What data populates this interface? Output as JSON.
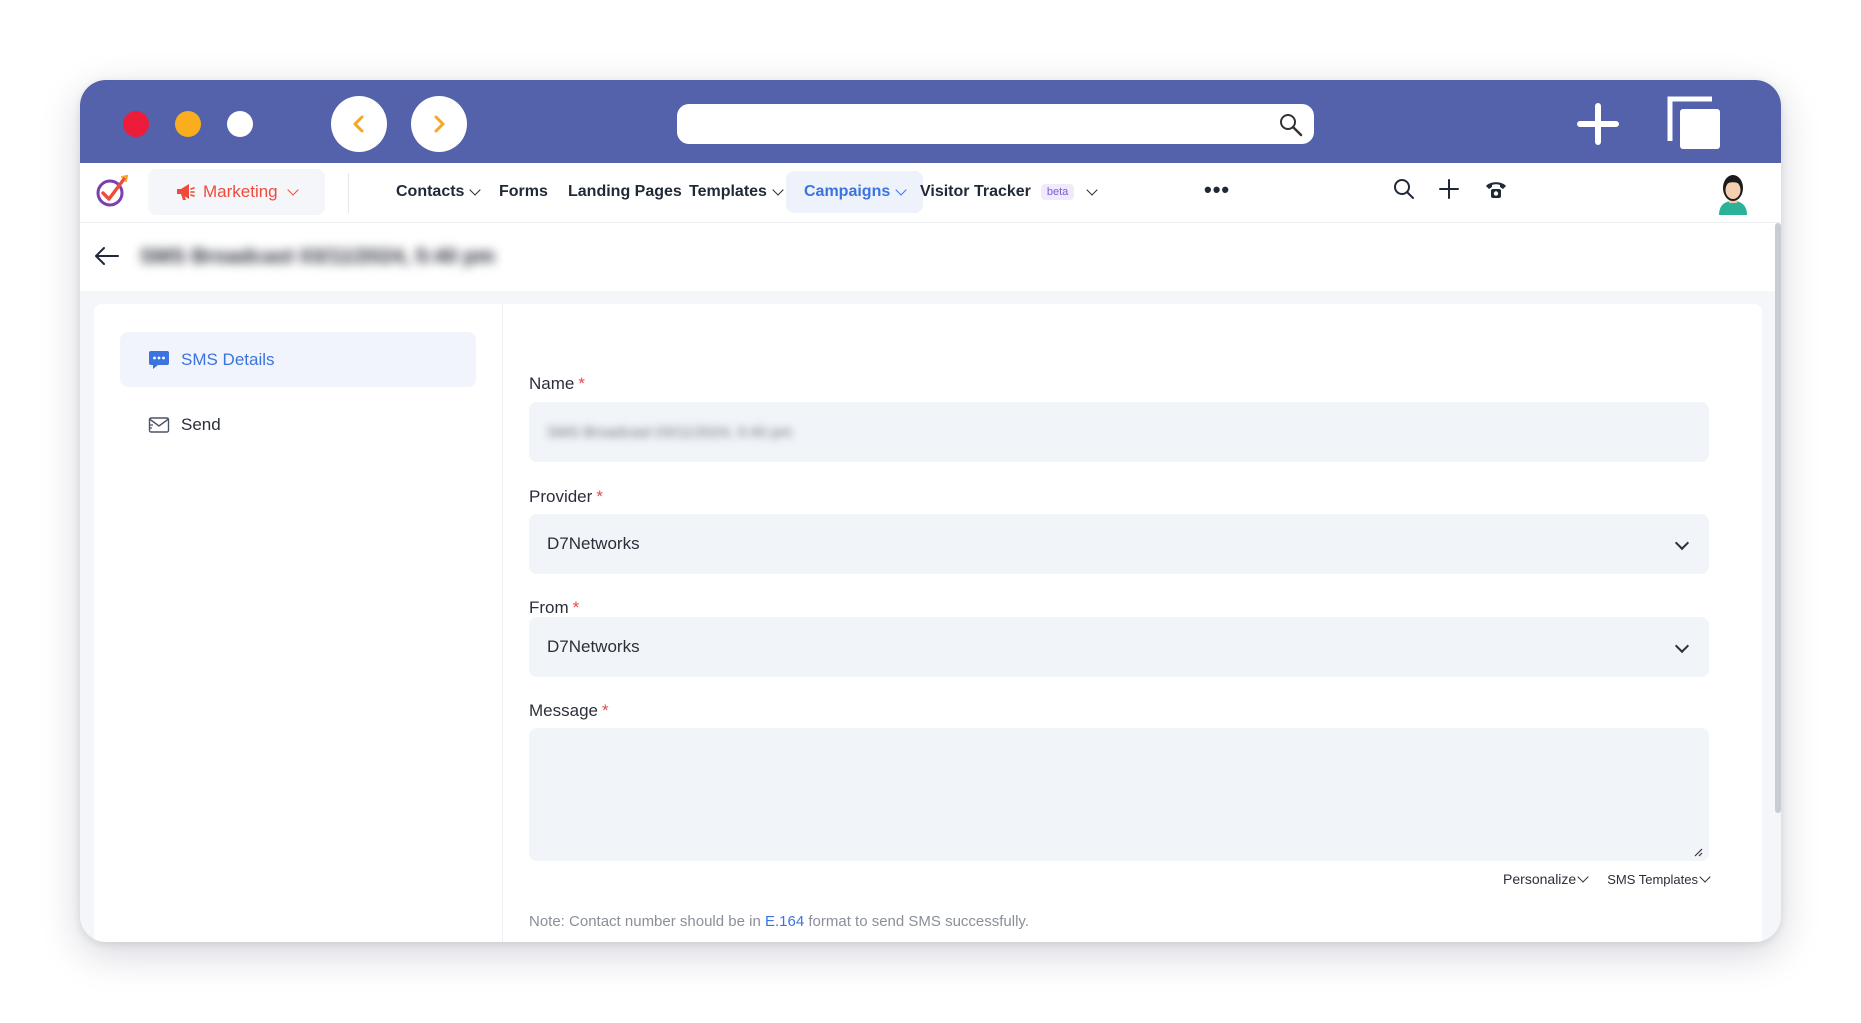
{
  "nav": {
    "module": "Marketing",
    "items": [
      {
        "label": "Contacts",
        "dropdown": true
      },
      {
        "label": "Forms",
        "dropdown": false
      },
      {
        "label": "Landing Pages",
        "dropdown": false
      },
      {
        "label": "Templates",
        "dropdown": true
      },
      {
        "label": "Campaigns",
        "dropdown": true,
        "active": true
      },
      {
        "label": "Visitor Tracker",
        "dropdown": true,
        "badge": "beta"
      }
    ],
    "more": "•••"
  },
  "page": {
    "title": "SMS Broadcast 03/11/2024, 5:40 pm"
  },
  "sidebar": {
    "items": [
      {
        "label": "SMS Details",
        "icon": "chat-bubble-icon",
        "active": true
      },
      {
        "label": "Send",
        "icon": "envelope-icon",
        "active": false
      }
    ]
  },
  "form": {
    "name_label": "Name",
    "name_value": "SMS Broadcast 03/11/2024, 5:40 pm",
    "provider_label": "Provider",
    "provider_value": "D7Networks",
    "from_label": "From",
    "from_value": "D7Networks",
    "message_label": "Message",
    "message_value": "",
    "required_mark": "*",
    "personalize": "Personalize",
    "sms_templates": "SMS Templates",
    "note_prefix": "Note: Contact number should be in ",
    "note_link": "E.164",
    "note_suffix": " format to send SMS successfully."
  },
  "colors": {
    "chrome": "#5462ab",
    "accent": "#3b74e0",
    "marketing": "#ef4b3a",
    "required": "#e5484d"
  }
}
